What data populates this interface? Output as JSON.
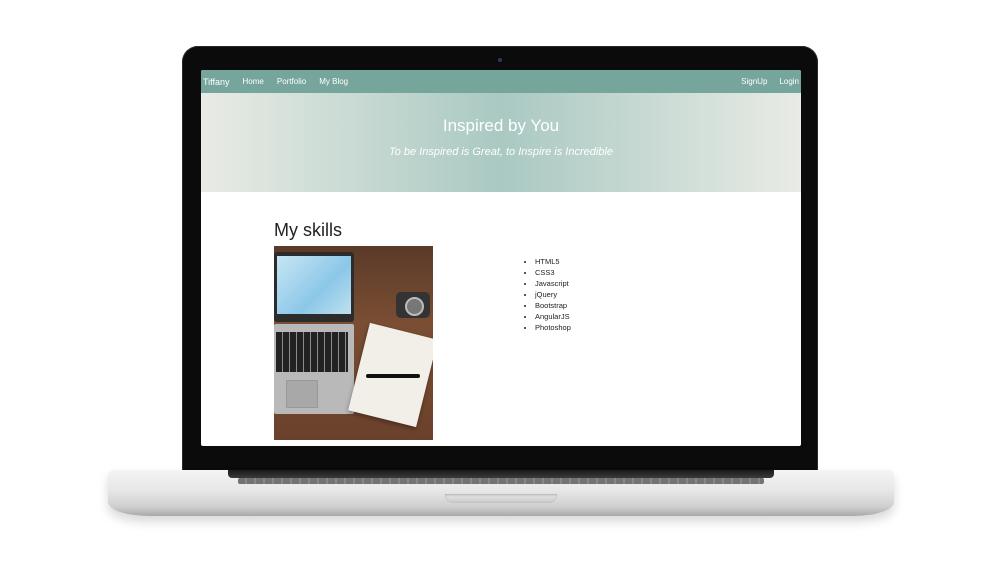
{
  "navbar": {
    "brand": "Tiffany",
    "links": [
      "Home",
      "Portfolio",
      "My Blog"
    ],
    "right_links": [
      "SignUp",
      "Login"
    ],
    "color": "#75a59b"
  },
  "hero": {
    "title": "Inspired by You",
    "subtitle": "To be Inspired is Great, to Inspire is Incredible"
  },
  "skills": {
    "heading": "My skills",
    "items": [
      "HTML5",
      "CSS3",
      "Javascript",
      "jQuery",
      "Bootstrap",
      "AngularJS",
      "Photoshop"
    ]
  }
}
